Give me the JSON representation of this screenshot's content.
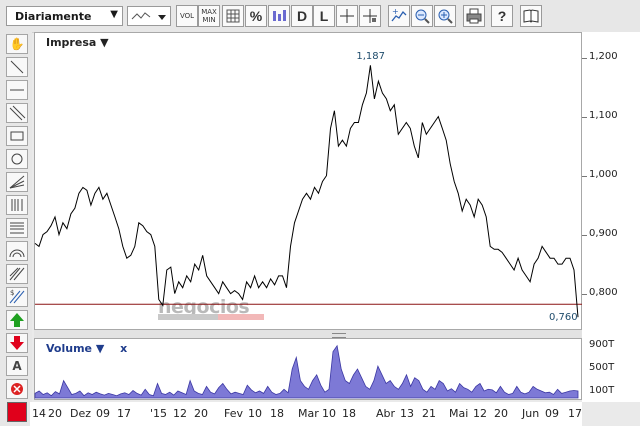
{
  "toolbar": {
    "period": "Diariamente",
    "vol_label": "VOL",
    "max_label": "MAX",
    "min_label": "MIN",
    "percent_label": "%",
    "d_label": "D",
    "l_label": "L",
    "help_label": "?"
  },
  "legend": {
    "series_label": "Impresa ▼",
    "volume_label": "Volume ▼",
    "volume_close": "x"
  },
  "watermark": {
    "text": "negocios"
  },
  "annotations": {
    "max_value": "1,187",
    "last_value": "0,760"
  },
  "yaxis": {
    "labels": [
      "1,200",
      "1,100",
      "1,000",
      "0,900",
      "0,800"
    ],
    "values": [
      1.2,
      1.1,
      1.0,
      0.9,
      0.8
    ]
  },
  "volume_axis": {
    "labels": [
      "900T",
      "500T",
      "100T"
    ],
    "values": [
      900,
      500,
      100
    ]
  },
  "xaxis": {
    "labels": [
      "14",
      "20",
      "Dez",
      "09",
      "17",
      "'15",
      "12",
      "20",
      "Fev",
      "10",
      "18",
      "Mar",
      "10",
      "18",
      "Abr",
      "13",
      "21",
      "Mai",
      "12",
      "20",
      "Jun",
      "09",
      "17"
    ]
  },
  "colors": {
    "line": "#000000",
    "reference": "#8c1414",
    "volume_fill": "#7d79d6",
    "volume_stroke": "#3b37a3",
    "swatch": "#e0001b"
  },
  "chart_data": {
    "type": "line",
    "ylim": [
      0.74,
      1.24
    ],
    "reference_line": 0.782,
    "values": [
      0.885,
      0.88,
      0.9,
      0.905,
      0.915,
      0.93,
      0.9,
      0.92,
      0.91,
      0.935,
      0.945,
      0.97,
      0.98,
      0.975,
      0.95,
      0.97,
      0.98,
      0.96,
      0.97,
      0.95,
      0.93,
      0.91,
      0.88,
      0.86,
      0.865,
      0.88,
      0.92,
      0.915,
      0.905,
      0.9,
      0.88,
      0.79,
      0.78,
      0.84,
      0.845,
      0.8,
      0.82,
      0.81,
      0.83,
      0.82,
      0.85,
      0.84,
      0.865,
      0.83,
      0.82,
      0.81,
      0.8,
      0.82,
      0.81,
      0.8,
      0.805,
      0.8,
      0.79,
      0.82,
      0.81,
      0.83,
      0.81,
      0.82,
      0.81,
      0.825,
      0.815,
      0.83,
      0.83,
      0.81,
      0.88,
      0.92,
      0.94,
      0.96,
      0.97,
      0.96,
      0.98,
      0.97,
      0.99,
      1.0,
      1.08,
      1.11,
      1.05,
      1.06,
      1.05,
      1.08,
      1.09,
      1.09,
      1.12,
      1.14,
      1.187,
      1.13,
      1.16,
      1.14,
      1.13,
      1.11,
      1.12,
      1.07,
      1.08,
      1.09,
      1.08,
      1.05,
      1.03,
      1.09,
      1.07,
      1.08,
      1.09,
      1.1,
      1.08,
      1.06,
      1.02,
      0.99,
      0.97,
      0.94,
      0.96,
      0.95,
      0.93,
      0.96,
      0.95,
      0.93,
      0.88,
      0.875,
      0.875,
      0.87,
      0.86,
      0.85,
      0.84,
      0.86,
      0.84,
      0.83,
      0.82,
      0.85,
      0.86,
      0.88,
      0.87,
      0.86,
      0.86,
      0.85,
      0.85,
      0.86,
      0.86,
      0.84,
      0.76
    ]
  },
  "volume_data": {
    "type": "area",
    "ylim": [
      0,
      1000
    ],
    "values": [
      80,
      120,
      60,
      90,
      40,
      110,
      70,
      300,
      180,
      60,
      80,
      120,
      40,
      90,
      60,
      100,
      70,
      50,
      80,
      60,
      40,
      70,
      90,
      60,
      130,
      80,
      50,
      150,
      60,
      40,
      250,
      80,
      60,
      100,
      50,
      120,
      90,
      60,
      300,
      120,
      80,
      60,
      200,
      100,
      70,
      180,
      250,
      150,
      70,
      100,
      80,
      60,
      220,
      140,
      90,
      120,
      80,
      200,
      100,
      60,
      80,
      150,
      90,
      500,
      700,
      300,
      200,
      150,
      300,
      400,
      220,
      100,
      150,
      800,
      900,
      500,
      300,
      250,
      400,
      500,
      350,
      200,
      150,
      300,
      550,
      400,
      250,
      300,
      200,
      150,
      250,
      400,
      200,
      350,
      300,
      150,
      100,
      200,
      150,
      300,
      250,
      120,
      160,
      100,
      250,
      180,
      150,
      100,
      200,
      250,
      120,
      150,
      140,
      90,
      200,
      100,
      60,
      80,
      200,
      100,
      70,
      100,
      200,
      150,
      120,
      90,
      100,
      60,
      150,
      80,
      100,
      120,
      130,
      120
    ]
  }
}
